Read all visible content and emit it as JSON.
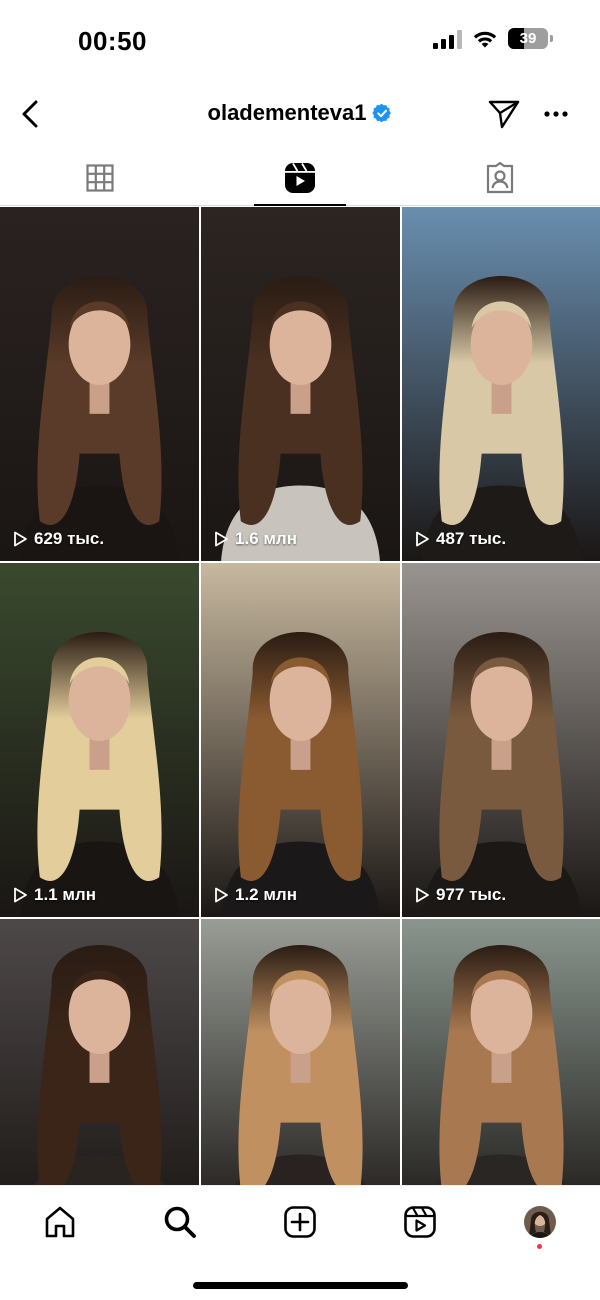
{
  "status_bar": {
    "time": "00:50",
    "battery": "39",
    "battery_level": 0.39
  },
  "header": {
    "username": "olademente­va1",
    "verified": true
  },
  "tabs": [
    {
      "icon": "grid-icon",
      "active": false
    },
    {
      "icon": "reels-icon",
      "active": true
    },
    {
      "icon": "tagged-icon",
      "active": false
    }
  ],
  "reels": [
    {
      "views": "629 тыс.",
      "hair": "dark-brown-waves",
      "colors": [
        "#2a2220",
        "#5a3a28",
        "#1a1412"
      ]
    },
    {
      "views": "1.6 млн",
      "hair": "dark-brown-long",
      "colors": [
        "#2c2522",
        "#4a3020",
        "#c8c4bd"
      ]
    },
    {
      "views": "487 тыс.",
      "hair": "blonde-balayage",
      "colors": [
        "#6a8fb0",
        "#d8c8a6",
        "#1d1a18"
      ]
    },
    {
      "views": "1.1 млн",
      "hair": "platinum-waves",
      "colors": [
        "#3a4a2e",
        "#e3cd9b",
        "#181512"
      ]
    },
    {
      "views": "1.2 млн",
      "hair": "caramel-lob",
      "colors": [
        "#c8b9a0",
        "#8a5a30",
        "#1a1818"
      ]
    },
    {
      "views": "977 тыс.",
      "hair": "bronde-waves",
      "colors": [
        "#9a9590",
        "#7a5a3e",
        "#1c1816"
      ]
    },
    {
      "views": "",
      "hair": "chocolate-bob",
      "colors": [
        "#555050",
        "#3a2518",
        "#2a2420"
      ]
    },
    {
      "views": "",
      "hair": "honey-bob",
      "colors": [
        "#aab0a8",
        "#c09060",
        "#2a2220"
      ]
    },
    {
      "views": "",
      "hair": "caramel-long",
      "colors": [
        "#9aa8a0",
        "#a87850",
        "#2a2624"
      ]
    }
  ],
  "bottom_nav": [
    {
      "icon": "home-icon"
    },
    {
      "icon": "search-icon"
    },
    {
      "icon": "create-icon"
    },
    {
      "icon": "reels-nav-icon"
    },
    {
      "icon": "profile-avatar"
    }
  ],
  "colors": {
    "verified": "#1b95f1",
    "notification": "#ff3040",
    "text": "#000000"
  }
}
